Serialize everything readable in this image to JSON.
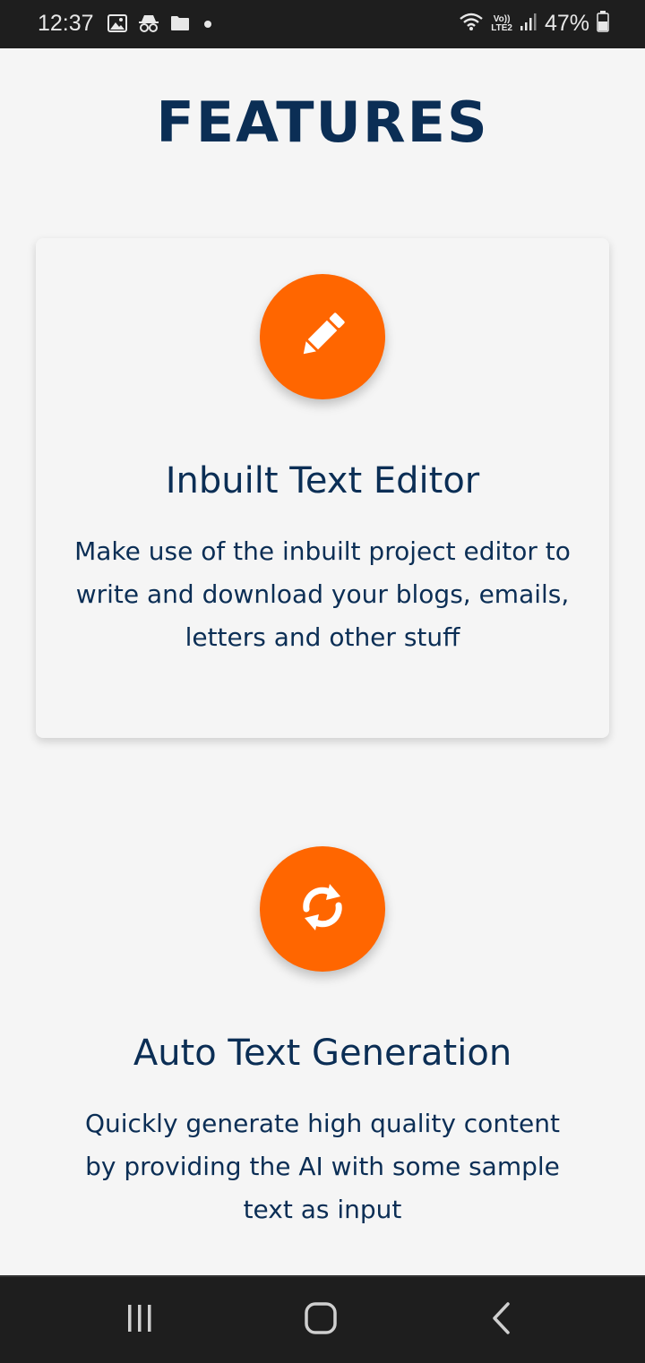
{
  "status_bar": {
    "time": "12:37",
    "network_top": "Vo))",
    "network_bottom": "LTE2",
    "battery": "47%",
    "icons_left": [
      "image-icon",
      "incognito-icon",
      "folder-icon",
      "dot-icon"
    ],
    "icons_right": [
      "wifi-icon",
      "signal-icon",
      "battery-icon"
    ]
  },
  "page": {
    "title": "FEATURES"
  },
  "features": [
    {
      "icon": "pencil-icon",
      "title": "Inbuilt Text Editor",
      "description": "Make use of the inbuilt project editor to write and download your blogs, emails, letters and other stuff"
    },
    {
      "icon": "sync-icon",
      "title": "Auto Text Generation",
      "description": "Quickly generate high quality content by providing the AI with some sample text as input"
    }
  ],
  "nav_bar": {
    "buttons": [
      "recents-icon",
      "home-icon",
      "back-icon"
    ]
  },
  "colors": {
    "accent": "#ff6600",
    "text": "#0b2e55",
    "background": "#f5f5f5",
    "system_bar": "#1e1e1e"
  }
}
